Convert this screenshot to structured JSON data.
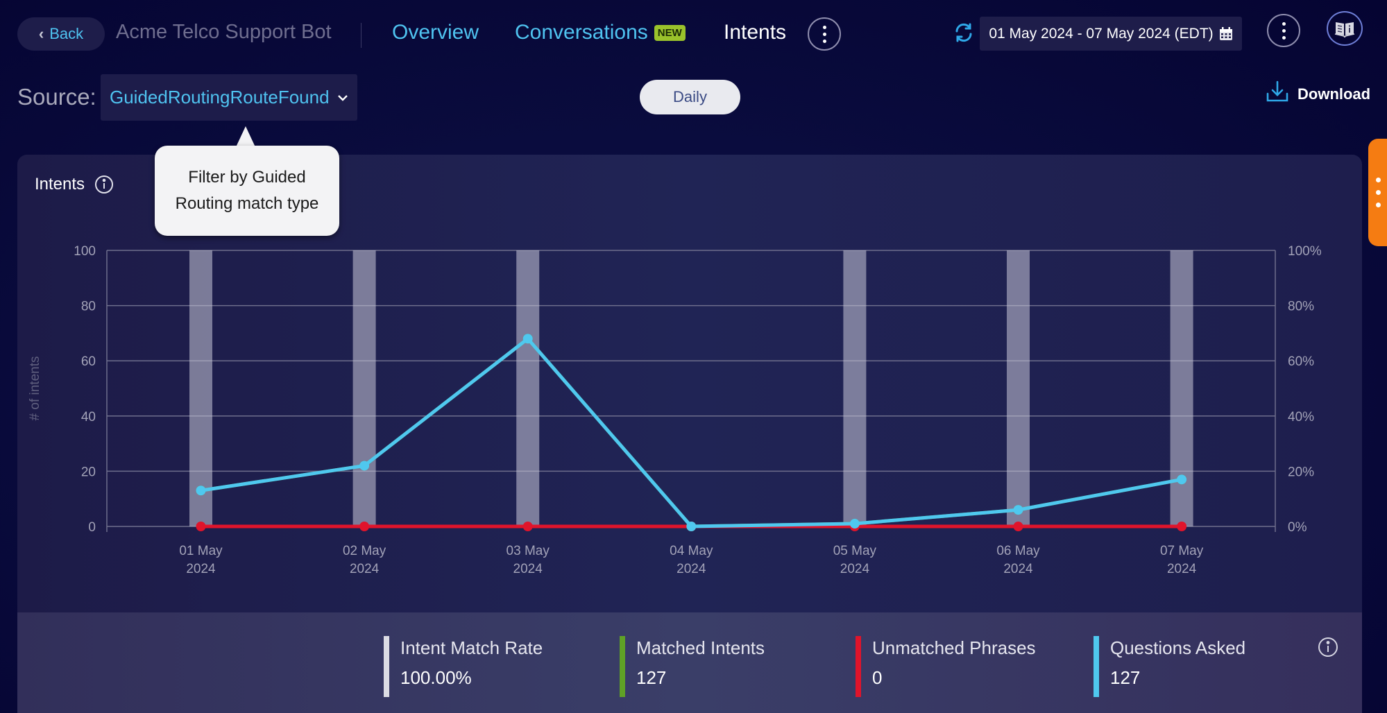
{
  "header": {
    "back_label": "Back",
    "bot_title": "Acme Telco Support Bot",
    "nav": [
      {
        "label": "Overview",
        "active": false
      },
      {
        "label": "Conversations",
        "badge": "NEW",
        "active": false
      },
      {
        "label": "Intents",
        "active": true
      }
    ],
    "date_range": "01 May 2024 - 07 May 2024 (EDT)"
  },
  "filters": {
    "source_label": "Source:",
    "source_value": "GuidedRoutingRouteFound",
    "granularity": "Daily",
    "download_label": "Download"
  },
  "tooltip": {
    "line1": "Filter by Guided",
    "line2": "Routing match type"
  },
  "card": {
    "title": "Intents"
  },
  "colors": {
    "accent": "#4fc3f0",
    "badge": "#9ac22b",
    "match_rate": "#dcdce4",
    "matched": "#5fa126",
    "unmatched": "#e0142b",
    "questions": "#4fc8ef",
    "side_tab": "#f57c12"
  },
  "chart_data": {
    "type": "bar+line",
    "title": "Intents",
    "categories": [
      "01 May 2024",
      "02 May 2024",
      "03 May 2024",
      "04 May 2024",
      "05 May 2024",
      "06 May 2024",
      "07 May 2024"
    ],
    "category_lines": [
      [
        "01 May",
        "2024"
      ],
      [
        "02 May",
        "2024"
      ],
      [
        "03 May",
        "2024"
      ],
      [
        "04 May",
        "2024"
      ],
      [
        "05 May",
        "2024"
      ],
      [
        "06 May",
        "2024"
      ],
      [
        "07 May",
        "2024"
      ]
    ],
    "ylabel": "# of intents",
    "ylim": [
      0,
      100
    ],
    "yticks": [
      0,
      20,
      40,
      60,
      80,
      100
    ],
    "y2lim": [
      0,
      100
    ],
    "y2ticks": [
      "0%",
      "20%",
      "40%",
      "60%",
      "80%",
      "100%"
    ],
    "grid": true,
    "series": [
      {
        "name": "Intent Match Rate",
        "type": "bar",
        "axis": "right",
        "unit": "%",
        "values": [
          100,
          100,
          100,
          0,
          100,
          100,
          100
        ]
      },
      {
        "name": "Matched Intents",
        "type": "line",
        "axis": "left",
        "values": [
          13,
          22,
          68,
          0,
          1,
          6,
          17
        ]
      },
      {
        "name": "Unmatched Phrases",
        "type": "line",
        "axis": "left",
        "values": [
          0,
          0,
          0,
          0,
          0,
          0,
          0
        ]
      },
      {
        "name": "Questions Asked",
        "type": "line",
        "axis": "left",
        "values": [
          13,
          22,
          68,
          0,
          1,
          6,
          17
        ]
      }
    ]
  },
  "summary": [
    {
      "label": "Intent Match Rate",
      "value": "100.00%",
      "color": "#dcdce4"
    },
    {
      "label": "Matched Intents",
      "value": "127",
      "color": "#5fa126"
    },
    {
      "label": "Unmatched Phrases",
      "value": "0",
      "color": "#e0142b"
    },
    {
      "label": "Questions Asked",
      "value": "127",
      "color": "#4fc8ef"
    }
  ]
}
